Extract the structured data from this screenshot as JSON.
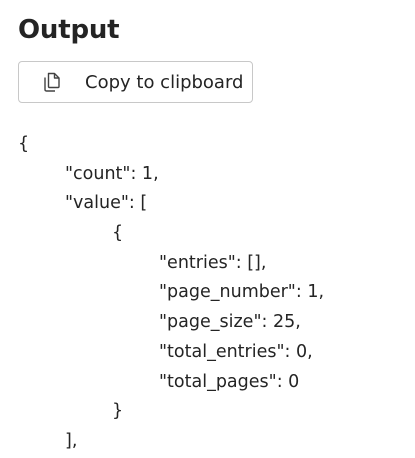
{
  "header": {
    "title": "Output"
  },
  "toolbar": {
    "copy_label": "Copy to clipboard",
    "copy_icon": "copy-icon"
  },
  "output": {
    "lines": [
      "{",
      "\"count\": 1,",
      "\"value\": [",
      "{",
      "\"entries\": [],",
      "\"page_number\": 1,",
      "\"page_size\": 25,",
      "\"total_entries\": 0,",
      "\"total_pages\": 0",
      "}",
      "],"
    ]
  }
}
